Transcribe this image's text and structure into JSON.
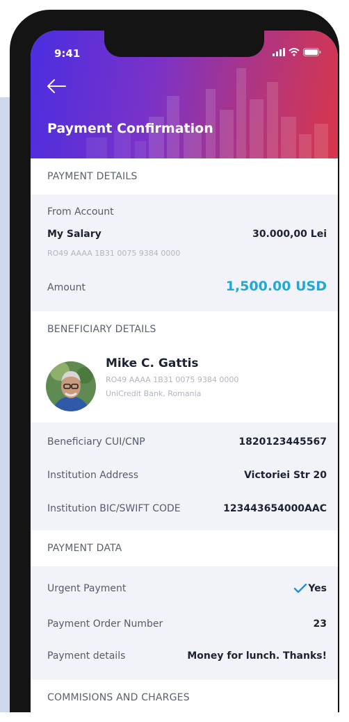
{
  "status": {
    "time": "9:41"
  },
  "header": {
    "title": "Payment Confirmation"
  },
  "payment_details": {
    "heading": "PAYMENT DETAILS",
    "from_label": "From Account",
    "account_name": "My Salary",
    "account_balance": "30.000,00 Lei",
    "account_iban": "RO49 AAAA 1B31 0075 9384 0000",
    "amount_label": "Amount",
    "amount_value": "1,500.00 USD"
  },
  "beneficiary": {
    "heading": "BENEFICIARY DETAILS",
    "name": "Mike C. Gattis",
    "iban": "RO49 AAAA 1B31 0075 9384 0000",
    "bank": "UniCredit Bank, Romania",
    "cui_label": "Beneficiary CUI/CNP",
    "cui_value": "1820123445567",
    "address_label": "Institution Address",
    "address_value": "Victoriei Str 20",
    "bic_label": "Institution BIC/SWIFT CODE",
    "bic_value": "123443654000AAC"
  },
  "payment_data": {
    "heading": "PAYMENT DATA",
    "urgent_label": "Urgent Payment",
    "urgent_value": "Yes",
    "order_label": "Payment Order Number",
    "order_value": "23",
    "details_label": "Payment details",
    "details_value": "Money for lunch. Thanks!"
  },
  "commissions": {
    "heading": "COMMISIONS AND CHARGES"
  },
  "colors": {
    "gradient_start": "#4a2ee0",
    "gradient_end": "#d8364a",
    "accent_amount": "#1fa8d8",
    "check": "#1f8fe0"
  },
  "icons": [
    "back-arrow-icon",
    "signal-icon",
    "wifi-icon",
    "battery-icon",
    "check-icon",
    "avatar"
  ]
}
